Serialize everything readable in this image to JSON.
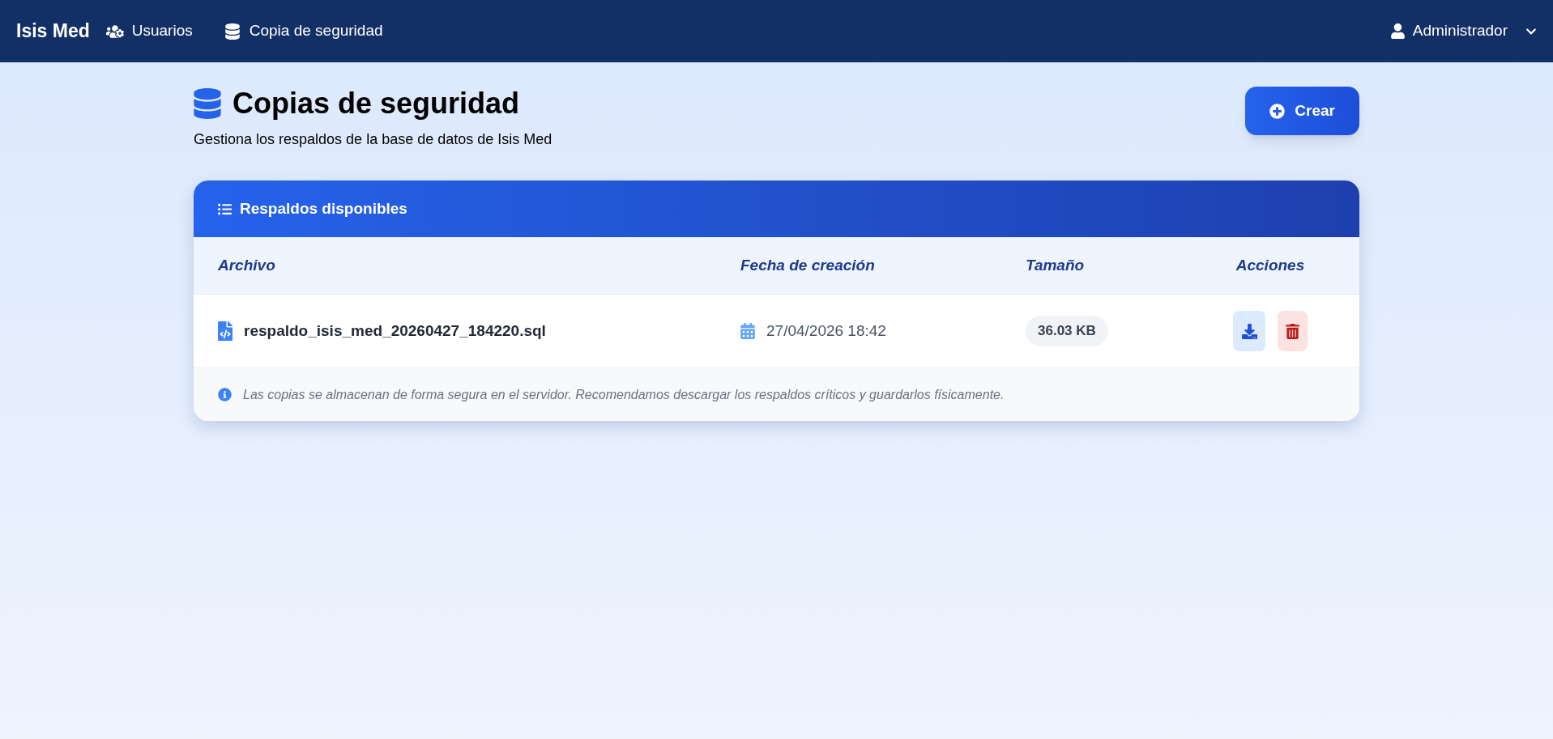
{
  "navbar": {
    "brand": "Isis Med",
    "links": [
      {
        "label": "Usuarios"
      },
      {
        "label": "Copia de seguridad"
      }
    ],
    "user": "Administrador"
  },
  "header": {
    "title": "Copias de seguridad",
    "subtitle": "Gestiona los respaldos de la base de datos de Isis Med",
    "create_button": "Crear"
  },
  "card": {
    "title": "Respaldos disponibles",
    "columns": [
      "Archivo",
      "Fecha de creación",
      "Tamaño",
      "Acciones"
    ],
    "rows": [
      {
        "file": "respaldo_isis_med_20260427_184220.sql",
        "date": "27/04/2026 18:42",
        "size": "36.03 KB"
      }
    ],
    "note": "Las copias se almacenan de forma segura en el servidor. Recomendamos descargar los respaldos críticos y guardarlos físicamente."
  }
}
